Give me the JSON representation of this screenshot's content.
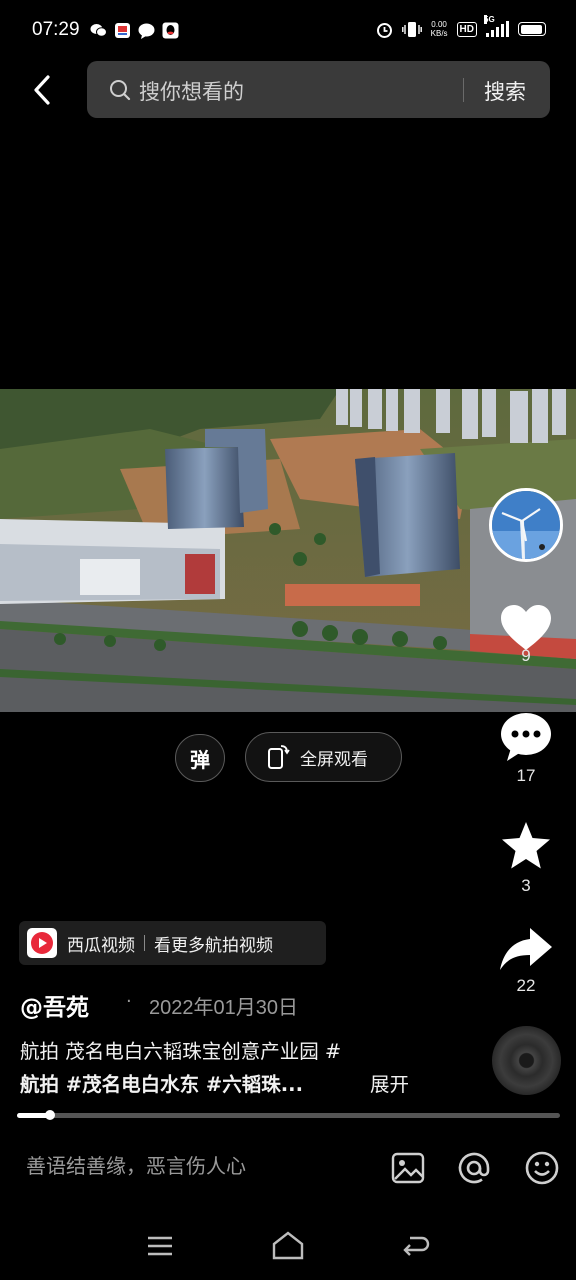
{
  "status_bar": {
    "time": "07:29",
    "net_speed_value": "0.00",
    "net_speed_unit": "KB/s",
    "hd": "HD",
    "network": "5G",
    "battery_level": 0.95
  },
  "header": {
    "back_icon": "chevron-left-icon",
    "search_placeholder": "搜你想看的",
    "search_button": "搜索"
  },
  "video": {
    "danmaku_label": "弹",
    "fullscreen_label": "全屏观看"
  },
  "actions": {
    "like_count": "9",
    "comment_count": "17",
    "favorite_count": "3",
    "share_count": "22"
  },
  "post": {
    "source_name": "西瓜视频",
    "source_more": "看更多航拍视频",
    "author": "@吾苑",
    "separator": "·",
    "date": "2022年01月30日",
    "caption_line1": "航拍 茂名电白六韬珠宝创意产业园 #",
    "caption_line2": "航拍 #茂名电白水东 #六韬珠...",
    "expand_label": "展开"
  },
  "progress": {
    "fraction": 0.06
  },
  "comment_bar": {
    "placeholder": "善语结善缘，恶言伤人心",
    "icons": [
      "image-icon",
      "mention-icon",
      "emoji-icon"
    ]
  },
  "colors": {
    "background": "#000000",
    "search_bg": "#3a3a3a",
    "muted_text": "#9a9a9a"
  }
}
